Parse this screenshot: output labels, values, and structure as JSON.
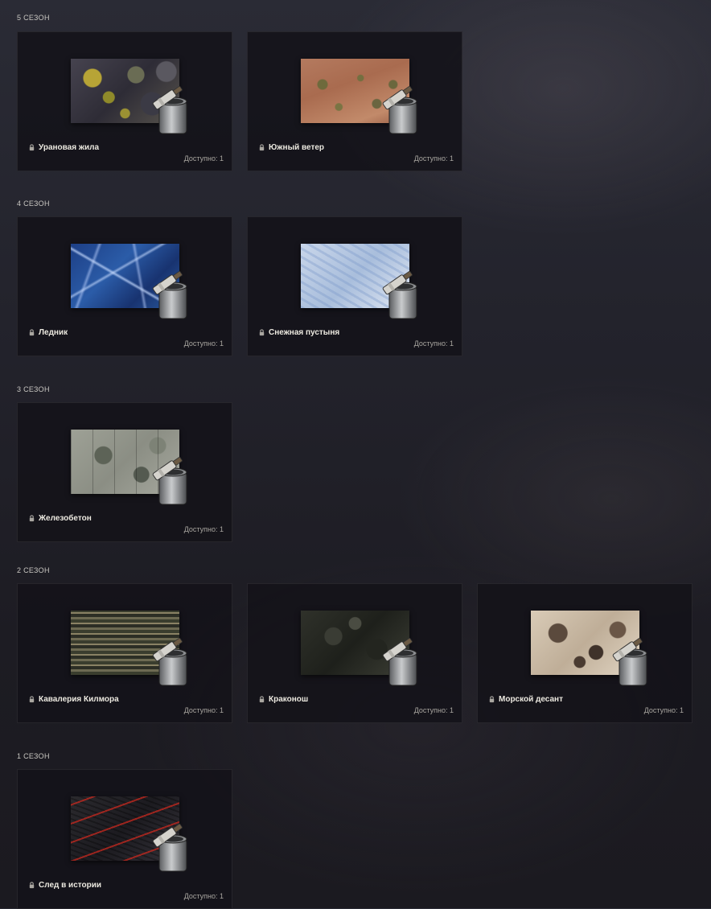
{
  "seasons": [
    {
      "title": "5 СЕЗОН",
      "items": [
        {
          "name": "Урановая жила",
          "available": "Доступно: 1",
          "icon": "lock-icon"
        },
        {
          "name": "Южный ветер",
          "available": "Доступно: 1",
          "icon": "lock-icon"
        }
      ]
    },
    {
      "title": "4 СЕЗОН",
      "items": [
        {
          "name": "Ледник",
          "available": "Доступно: 1",
          "icon": "lock-icon"
        },
        {
          "name": "Снежная пустыня",
          "available": "Доступно: 1",
          "icon": "lock-icon"
        }
      ]
    },
    {
      "title": "3 СЕЗОН",
      "items": [
        {
          "name": "Железобетон",
          "available": "Доступно: 1",
          "icon": "lock-icon"
        }
      ]
    },
    {
      "title": "2 СЕЗОН",
      "items": [
        {
          "name": "Кавалерия Килмора",
          "available": "Доступно: 1",
          "icon": "lock-icon"
        },
        {
          "name": "Краконош",
          "available": "Доступно: 1",
          "icon": "lock-icon"
        },
        {
          "name": "Морской десант",
          "available": "Доступно: 1",
          "icon": "lock-icon"
        }
      ]
    },
    {
      "title": "1 СЕЗОН",
      "items": [
        {
          "name": "След в истории",
          "available": "Доступно: 1",
          "icon": "lock-icon"
        }
      ]
    }
  ],
  "icons": {
    "lock": "lock-icon",
    "paint_can": "paint-can-icon"
  }
}
